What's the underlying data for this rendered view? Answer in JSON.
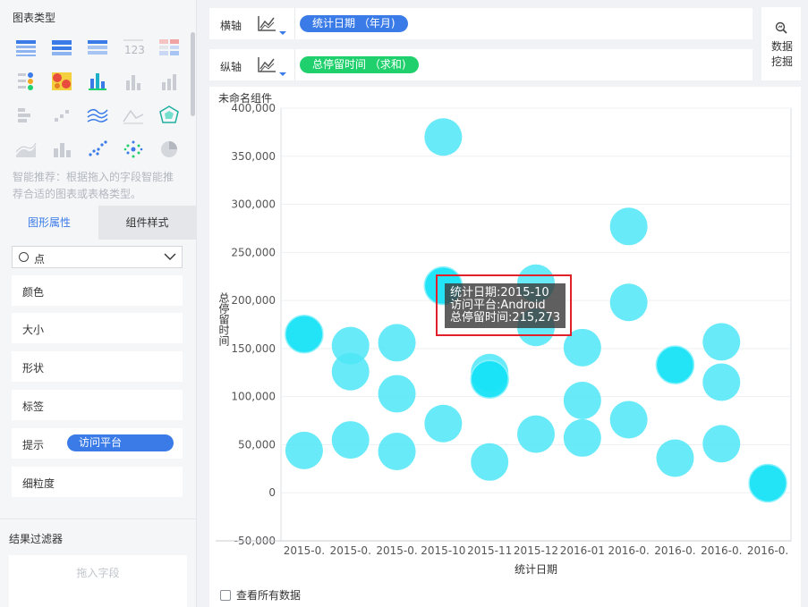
{
  "left_panel": {
    "chart_type_title": "图表类型",
    "chart_types": [
      "table-icon",
      "cross-table-icon",
      "detail-table-icon",
      "kpi-number-icon",
      "color-table-icon",
      "point-legend-icon",
      "heatmap-icon",
      "dot-column-icon",
      "column-icon",
      "bar-icon",
      "block-icon",
      "scatter-small-icon",
      "multi-line-icon",
      "area-line-icon",
      "radar-icon",
      "area-icon",
      "stacked-column-icon",
      "scatter-icon",
      "bubble-cluster-icon",
      "pie-icon"
    ],
    "smart_tip": "智能推荐：根据拖入的字段智能推荐合适的图表或表格类型。",
    "tabs": {
      "graph_props": "图形属性",
      "component_style": "组件样式"
    },
    "mark_type": "点",
    "properties": [
      {
        "label": "颜色"
      },
      {
        "label": "大小"
      },
      {
        "label": "形状"
      },
      {
        "label": "标签"
      },
      {
        "label": "提示",
        "pill": "访问平台"
      },
      {
        "label": "细粒度"
      }
    ],
    "filter_title": "结果过滤器",
    "filter_placeholder": "拖入字段"
  },
  "shelves": {
    "x": {
      "label": "横轴",
      "field": "统计日期 （年月)",
      "color": "#3a7be8"
    },
    "y": {
      "label": "纵轴",
      "field": "总停留时间 （求和)",
      "color": "#1fd06c"
    }
  },
  "data_mining": "数据挖掘",
  "component_title": "未命名组件",
  "show_all_label": "查看所有数据",
  "tooltip": {
    "line1": "统计日期:2015-10",
    "line2": "访问平台:Android",
    "line3": "总停留时间:215,273"
  },
  "chart_data": {
    "type": "scatter",
    "title": "",
    "xlabel": "统计日期",
    "ylabel": "总停留时间",
    "categories": [
      "2015-0.",
      "2015-0.",
      "2015-0.",
      "2015-10",
      "2015-11",
      "2015-12",
      "2016-01",
      "2016-0.",
      "2016-0.",
      "2016-0.",
      "2016-0."
    ],
    "ylim": [
      -50000,
      400000
    ],
    "yticks": [
      -50000,
      0,
      50000,
      100000,
      150000,
      200000,
      250000,
      300000,
      350000,
      400000
    ],
    "ytick_labels": [
      "-50,000",
      "0",
      "50,000",
      "100,000",
      "150,000",
      "200,000",
      "250,000",
      "300,000",
      "350,000",
      "400,000"
    ],
    "marker_color": "#4fe6f7",
    "highlight_color": "#17e3f7",
    "grid": "horizontal",
    "points": [
      {
        "cat": 0,
        "y": 165000,
        "hl": true
      },
      {
        "cat": 0,
        "y": 44000
      },
      {
        "cat": 1,
        "y": 153000
      },
      {
        "cat": 1,
        "y": 126000
      },
      {
        "cat": 1,
        "y": 55000
      },
      {
        "cat": 2,
        "y": 156000
      },
      {
        "cat": 2,
        "y": 103000
      },
      {
        "cat": 2,
        "y": 43000
      },
      {
        "cat": 3,
        "y": 370000
      },
      {
        "cat": 3,
        "y": 215273,
        "hl": true
      },
      {
        "cat": 3,
        "y": 72000
      },
      {
        "cat": 4,
        "y": 125000
      },
      {
        "cat": 4,
        "y": 118000,
        "hl": true
      },
      {
        "cat": 4,
        "y": 32000
      },
      {
        "cat": 5,
        "y": 218000
      },
      {
        "cat": 5,
        "y": 172000
      },
      {
        "cat": 5,
        "y": 61000
      },
      {
        "cat": 6,
        "y": 151000
      },
      {
        "cat": 6,
        "y": 96000
      },
      {
        "cat": 6,
        "y": 57000
      },
      {
        "cat": 7,
        "y": 277000
      },
      {
        "cat": 7,
        "y": 198000
      },
      {
        "cat": 7,
        "y": 76000
      },
      {
        "cat": 8,
        "y": 133000,
        "hl": true
      },
      {
        "cat": 8,
        "y": 36000
      },
      {
        "cat": 9,
        "y": 157000
      },
      {
        "cat": 9,
        "y": 115000
      },
      {
        "cat": 9,
        "y": 51000
      },
      {
        "cat": 10,
        "y": 10000,
        "hl": true
      }
    ]
  }
}
